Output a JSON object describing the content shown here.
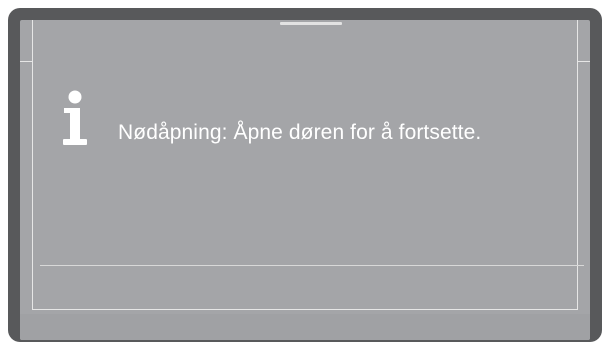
{
  "dialog": {
    "message": "Nødåpning: Åpne døren for å fortsette."
  },
  "icons": {
    "info": "info-icon"
  },
  "colors": {
    "bezel": "#58595b",
    "screen": "#a4a5a8",
    "text": "#ffffff"
  }
}
